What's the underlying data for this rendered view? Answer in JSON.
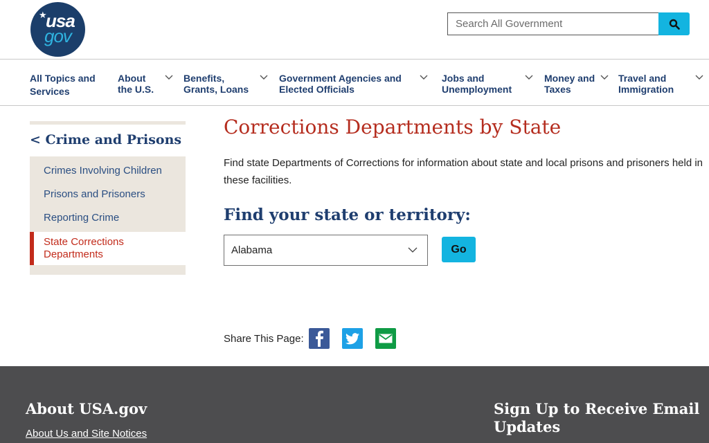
{
  "header": {
    "logo": {
      "top": "usa",
      "bottom": "gov",
      "alt": "USAGov logo"
    },
    "search": {
      "placeholder": "Search All Government",
      "value": "",
      "button_icon": "search-icon"
    }
  },
  "nav": {
    "items": [
      {
        "line1": "All Topics and",
        "line2": "Services",
        "has_dropdown": false
      },
      {
        "line1": "About",
        "line2": "the U.S.",
        "has_dropdown": true
      },
      {
        "line1": "Benefits,",
        "line2": "Grants, Loans",
        "has_dropdown": true
      },
      {
        "line1": "Government Agencies and",
        "line2": "Elected Officials",
        "has_dropdown": true
      },
      {
        "line1": "Jobs and",
        "line2": "Unemployment",
        "has_dropdown": true
      },
      {
        "line1": "Money and",
        "line2": "Taxes",
        "has_dropdown": true
      },
      {
        "line1": "Travel and",
        "line2": "Immigration",
        "has_dropdown": true
      }
    ]
  },
  "sidebar": {
    "parent": "< Crime and Prisons",
    "items": [
      {
        "label": "Crimes Involving Children",
        "active": false
      },
      {
        "label": "Prisons and Prisoners",
        "active": false
      },
      {
        "label": "Reporting Crime",
        "active": false
      },
      {
        "label": "State Corrections Departments",
        "active": true
      }
    ]
  },
  "main": {
    "title": "Corrections Departments by State",
    "intro": "Find state Departments of Corrections for information about state and local prisons and prisoners held in these facilities.",
    "find_heading": "Find your state or territory:",
    "state_select": {
      "selected": "Alabama"
    },
    "go_label": "Go"
  },
  "share": {
    "label": "Share This Page:",
    "icons": [
      "facebook-icon",
      "twitter-icon",
      "email-icon"
    ]
  },
  "footer": {
    "about_heading": "About USA.gov",
    "about_link": "About Us and Site Notices",
    "signup_heading_line1": "Sign Up to Receive Email",
    "signup_heading_line2": "Updates"
  },
  "colors": {
    "brand_navy": "#1b3e6a",
    "link_blue": "#1f3e6f",
    "accent_cyan": "#13b4e0",
    "title_red": "#b52d1f",
    "sidebar_bg": "#ebe6de",
    "footer_bg": "#4d4d4f"
  }
}
